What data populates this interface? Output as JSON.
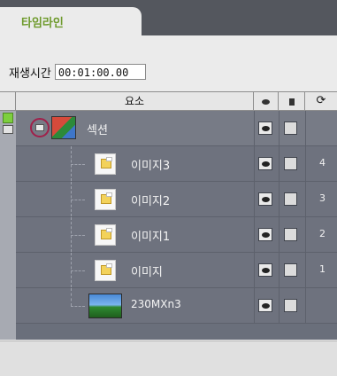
{
  "tab": {
    "label": "타임라인"
  },
  "playtime": {
    "label": "재생시간",
    "value": "00:01:00.00"
  },
  "columns": {
    "element": "요소"
  },
  "section": {
    "name": "섹션"
  },
  "rows": [
    {
      "name": "이미지3",
      "order": "4"
    },
    {
      "name": "이미지2",
      "order": "3"
    },
    {
      "name": "이미지1",
      "order": "2"
    },
    {
      "name": "이미지",
      "order": "1"
    },
    {
      "name": "230MXn3",
      "order": ""
    }
  ],
  "colors": {
    "tab_text": "#6e9a2c",
    "row_bg": "#6e727e",
    "highlight_ring": "#a0204a",
    "green_marker": "#7dcf3e"
  }
}
